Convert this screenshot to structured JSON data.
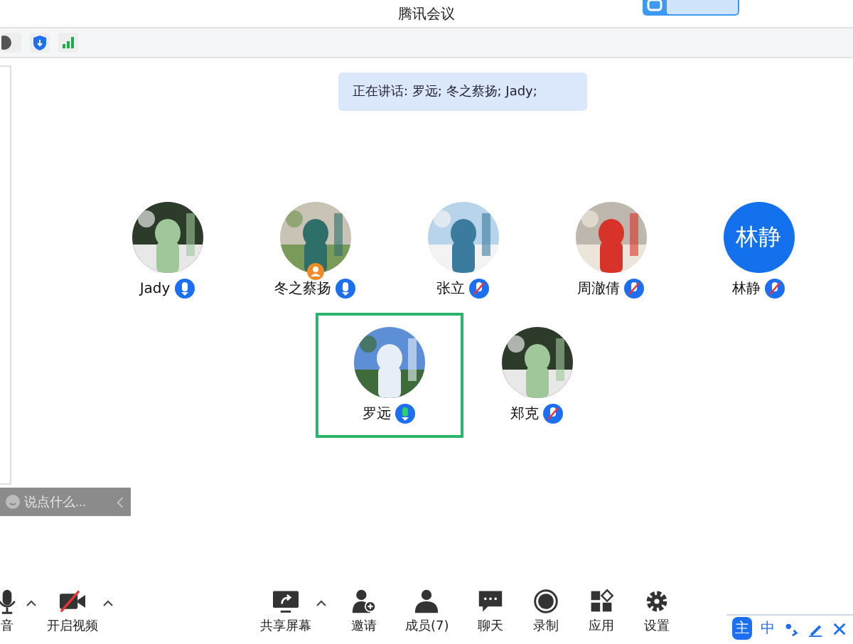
{
  "window": {
    "title": "腾讯会议"
  },
  "speaking_banner": "正在讲话: 罗远; 冬之蔡扬; Jady;",
  "participants": [
    {
      "name": "Jady",
      "muted": false,
      "speaking": false,
      "host": false,
      "selected": false
    },
    {
      "name": "冬之蔡扬",
      "muted": false,
      "speaking": false,
      "host": true,
      "selected": false
    },
    {
      "name": "张立",
      "muted": true,
      "speaking": false,
      "host": false,
      "selected": false
    },
    {
      "name": "周澈倩",
      "muted": true,
      "speaking": false,
      "host": false,
      "selected": false
    },
    {
      "name": "林静",
      "avatar": {
        "kind": "text",
        "text": "林静"
      },
      "muted": true,
      "speaking": false,
      "host": false,
      "selected": false
    },
    {
      "name": "罗远",
      "muted": false,
      "speaking": true,
      "host": false,
      "selected": true
    },
    {
      "name": "郑克",
      "muted": true,
      "speaking": false,
      "host": false,
      "selected": false
    }
  ],
  "chat_input": {
    "placeholder": "说点什么..."
  },
  "toolbar": [
    {
      "kind": "mic",
      "label": "音",
      "menu": true
    },
    {
      "kind": "video-off",
      "label": "开启视频",
      "menu": true
    },
    {
      "kind": "share",
      "label": "共享屏幕",
      "menu": true
    },
    {
      "kind": "invite",
      "label": "邀请",
      "menu": false
    },
    {
      "kind": "members",
      "label": "成员(7)",
      "menu": false
    },
    {
      "kind": "chat",
      "label": "聊天",
      "menu": false
    },
    {
      "kind": "record",
      "label": "录制",
      "menu": false
    },
    {
      "kind": "apps",
      "label": "应用",
      "menu": false
    },
    {
      "kind": "settings",
      "label": "设置",
      "menu": false
    }
  ],
  "ime_bar": {
    "logo": "主",
    "mode": "中"
  }
}
